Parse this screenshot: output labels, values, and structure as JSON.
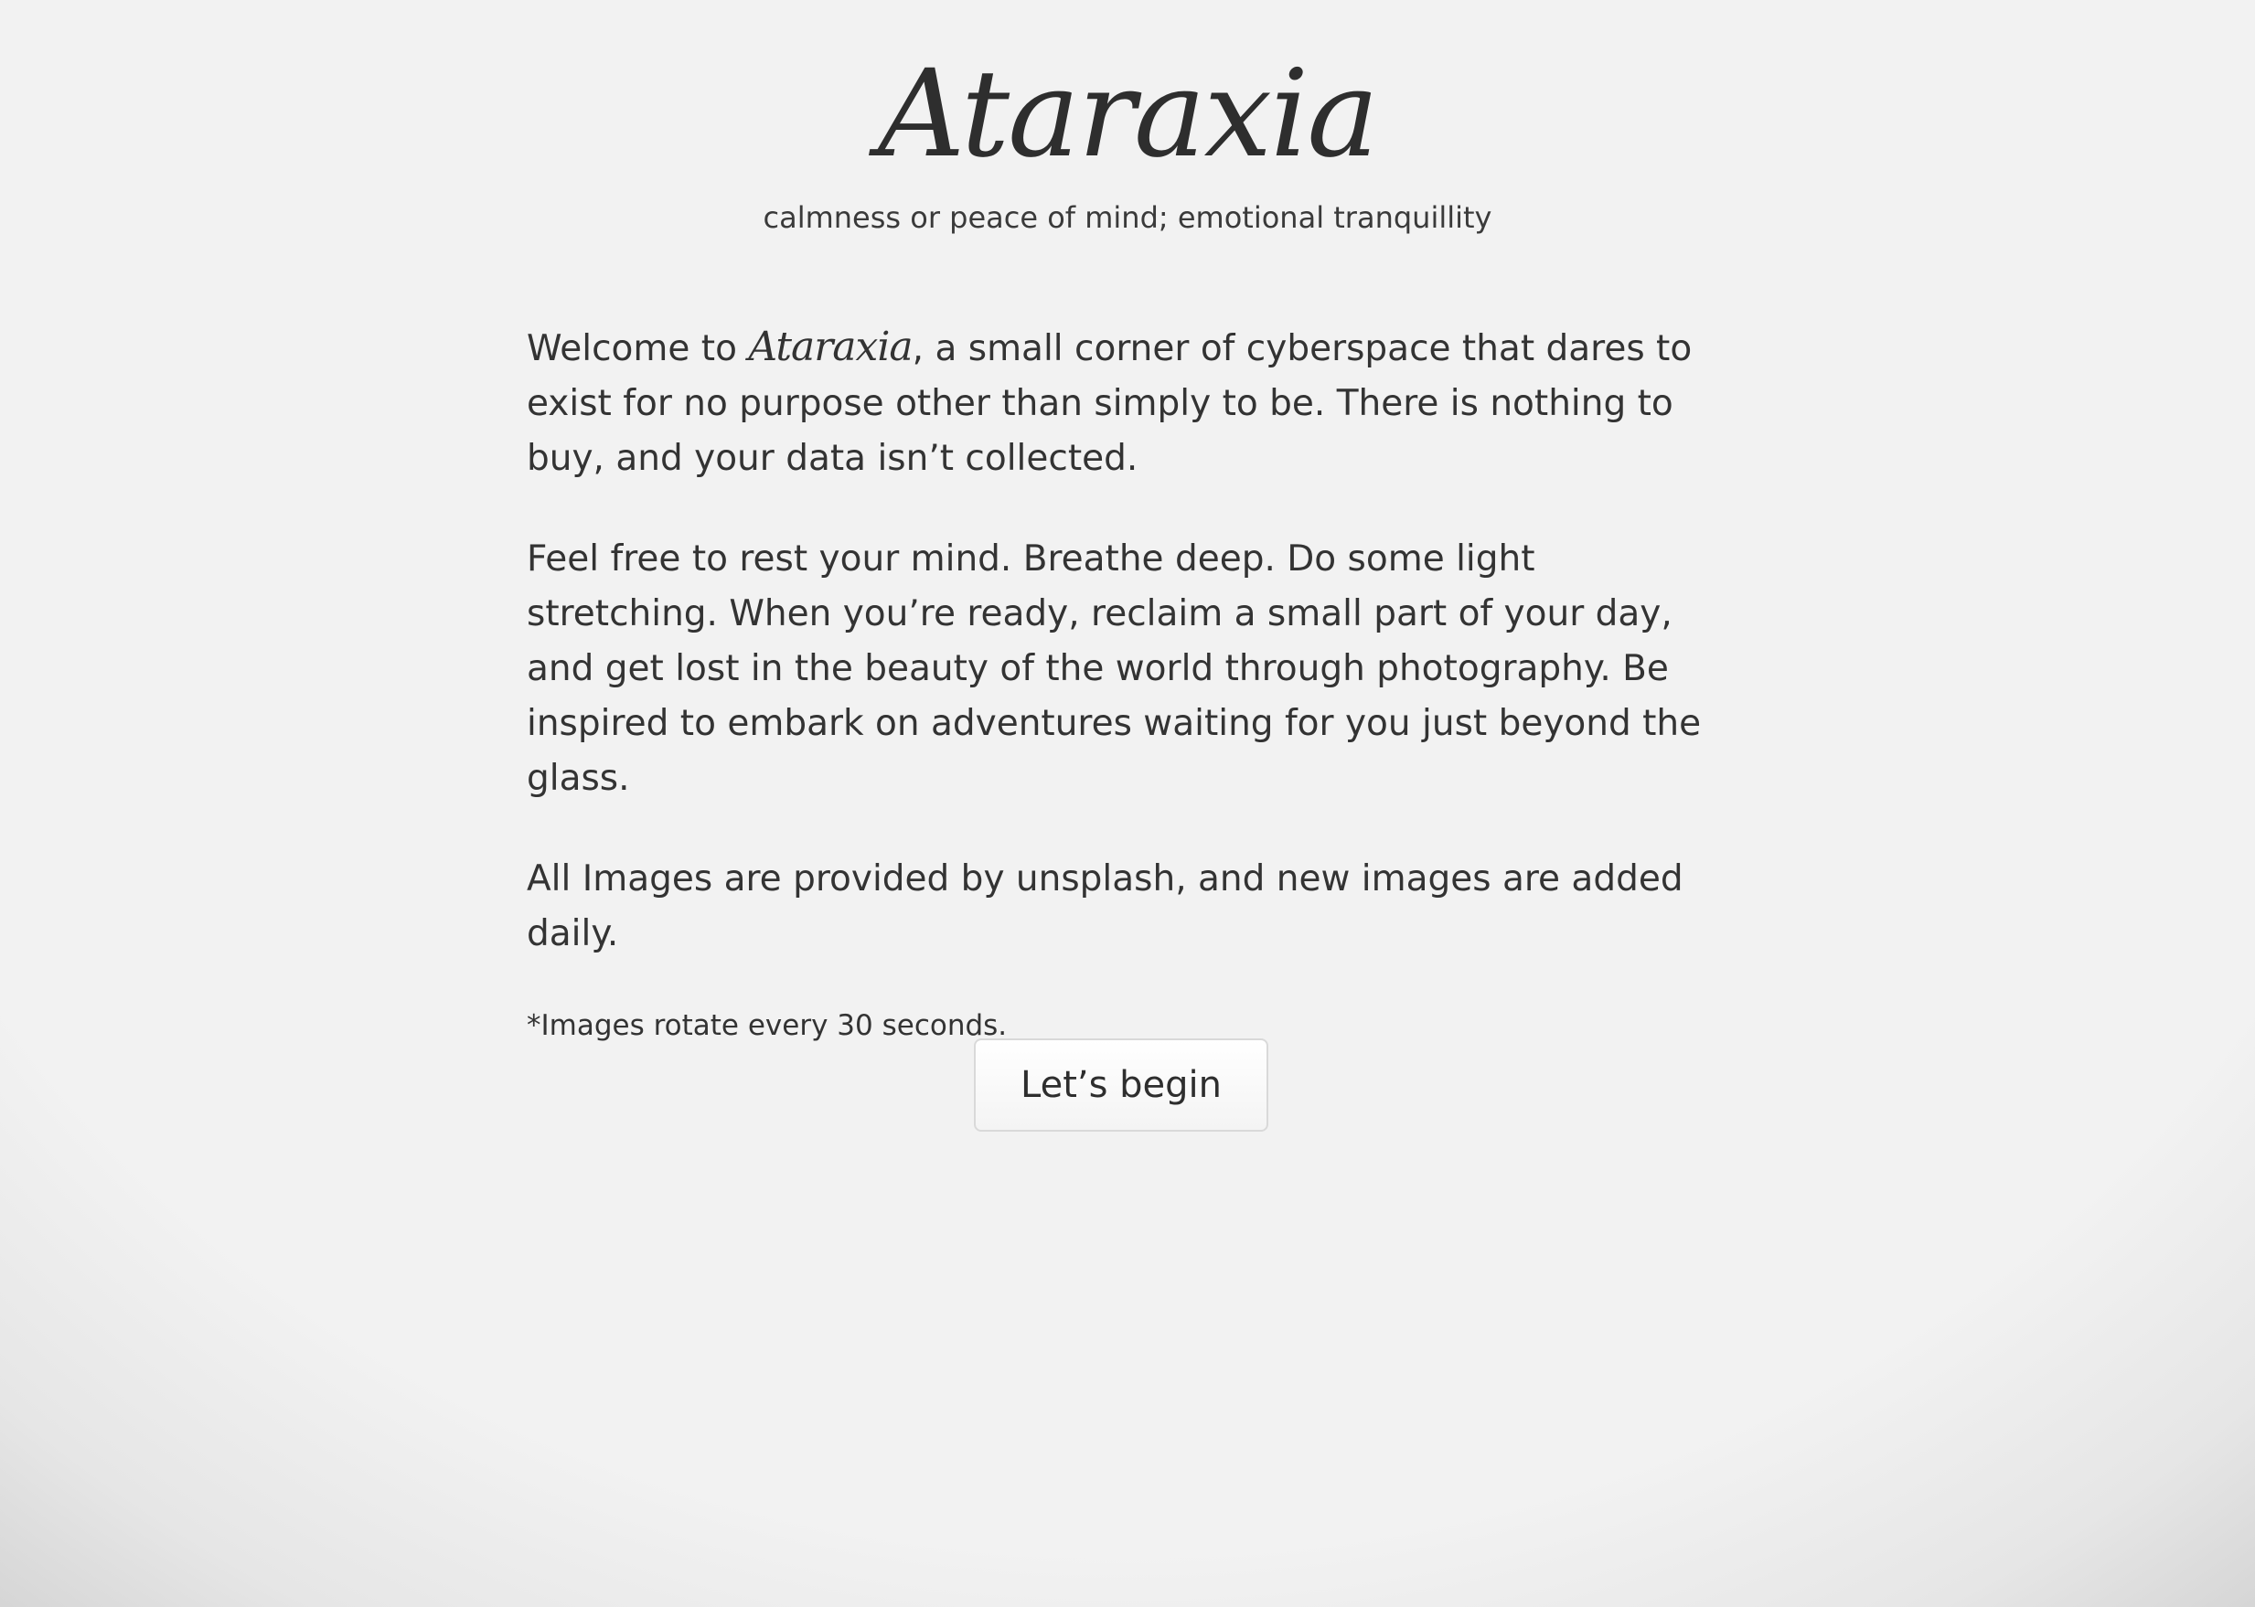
{
  "header": {
    "logo_text": "Ataraxia",
    "tagline": "calmness or peace of mind; emotional tranquillity"
  },
  "intro": {
    "welcome_prefix": "Welcome to ",
    "welcome_brand": "Ataraxia",
    "welcome_suffix": ", a small corner of cyberspace that dares to exist for no purpose other than simply to be. There is nothing to buy, and your data isn’t collected.",
    "paragraph_2": "Feel free to rest your mind. Breathe deep. Do some light stretching. When you’re ready, reclaim a small part of your day, and get lost in the beauty of the world through photography. Be inspired to embark on adventures waiting for you just beyond the glass.",
    "paragraph_3": "All Images are provided by unsplash, and new images are added daily.",
    "footnote": "*Images rotate every 30 seconds."
  },
  "actions": {
    "begin_label": "Let’s begin"
  },
  "colors": {
    "text": "#333333",
    "background": "#f2f2f2",
    "vignette": "#d3d3d3",
    "button_border": "#d9d9d9"
  }
}
